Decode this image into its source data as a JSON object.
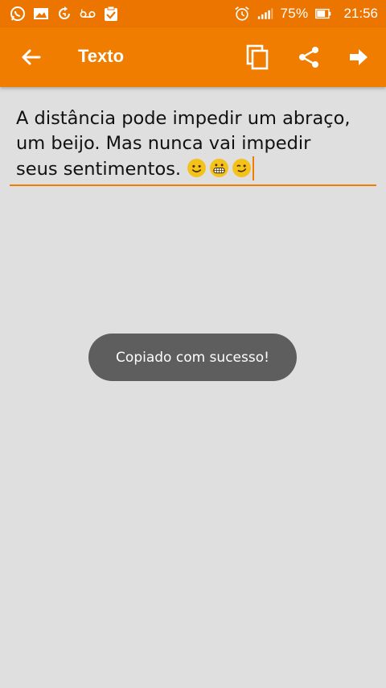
{
  "status_bar": {
    "notification_icons": [
      "whatsapp-icon",
      "image-icon",
      "sync-icon",
      "voicemail-icon",
      "clipboard-check-icon"
    ],
    "alarm_icon": "alarm-icon",
    "signal_icon": "signal-icon",
    "battery_percent": "75%",
    "battery_level": 0.75,
    "time": "21:56"
  },
  "app_bar": {
    "title": "Texto",
    "back_icon": "arrow-back-icon",
    "actions": [
      "copy-icon",
      "share-icon",
      "arrow-forward-icon"
    ]
  },
  "editor": {
    "text": "A distância pode impedir um abraço,\num beijo. Mas nunca vai impedir\nseus sentimentos. ",
    "emojis": [
      "smile-emoji",
      "grin-emoji",
      "wink-emoji"
    ]
  },
  "toast": {
    "message": "Copiado com sucesso!"
  },
  "colors": {
    "status_bar": "#ec7500",
    "app_bar": "#f07d00",
    "background": "#dfdfdf",
    "toast_bg": "#5e5e5e"
  }
}
